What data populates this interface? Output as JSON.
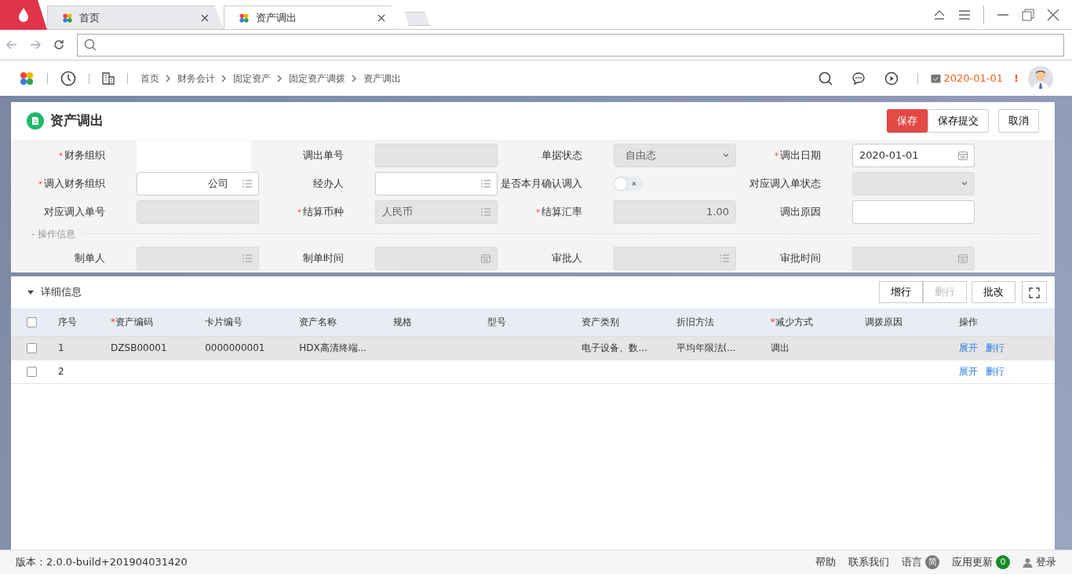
{
  "browser": {
    "tabs": [
      {
        "label": "首页",
        "selected": false
      },
      {
        "label": "资产调出",
        "selected": true
      }
    ]
  },
  "app_header": {
    "breadcrumb": [
      "首页",
      "财务会计",
      "固定资产",
      "固定资产调拨",
      "资产调出"
    ],
    "date": "2020-01-01",
    "alert": "!"
  },
  "page": {
    "title": "资产调出",
    "buttons": [
      {
        "label": "保存",
        "kind": "primary"
      },
      {
        "label": "保存提交",
        "kind": "default"
      },
      {
        "label": "取消",
        "kind": "default"
      }
    ]
  },
  "required_mark": "*",
  "form": {
    "fields": [
      {
        "label": "财务组织",
        "required": true,
        "kind": "redacted"
      },
      {
        "label": "调出单号",
        "required": false,
        "kind": "text",
        "disabled": true
      },
      {
        "label": "单据状态",
        "required": false,
        "kind": "select",
        "value": "自由态",
        "disabled": true
      },
      {
        "label": "调出日期",
        "required": true,
        "kind": "date",
        "value": "2020-01-01",
        "disabled": false
      },
      {
        "label": "调入财务组织",
        "required": true,
        "kind": "list",
        "value": "公司",
        "disabled": false
      },
      {
        "label": "经办人",
        "required": false,
        "kind": "list",
        "disabled": false
      },
      {
        "label": "是否本月确认调入",
        "required": false,
        "kind": "toggle",
        "on": false
      },
      {
        "label": "对应调入单状态",
        "required": false,
        "kind": "select",
        "disabled": true
      },
      {
        "label": "对应调入单号",
        "required": false,
        "kind": "text",
        "disabled": true
      },
      {
        "label": "结算币种",
        "required": true,
        "kind": "list",
        "value": "人民币",
        "disabled": true
      },
      {
        "label": "结算汇率",
        "required": true,
        "kind": "number",
        "value": "1.00",
        "disabled": true
      },
      {
        "label": "调出原因",
        "required": false,
        "kind": "text",
        "disabled": false
      }
    ],
    "section": "- 操作信息",
    "section_fields": [
      {
        "label": "制单人",
        "required": false,
        "kind": "list",
        "disabled": true
      },
      {
        "label": "制单时间",
        "required": false,
        "kind": "date",
        "disabled": true
      },
      {
        "label": "审批人",
        "required": false,
        "kind": "list",
        "disabled": true
      },
      {
        "label": "审批时间",
        "required": false,
        "kind": "date",
        "disabled": true
      }
    ]
  },
  "detail": {
    "title": "详细信息",
    "expanded": true,
    "all_checked": false,
    "buttons": [
      {
        "label": "增行",
        "disabled": false
      },
      {
        "label": "删行",
        "disabled": true
      },
      {
        "label": "批改",
        "disabled": false
      }
    ],
    "columns": [
      {
        "label": "序号",
        "required": false
      },
      {
        "label": "资产编码",
        "required": true
      },
      {
        "label": "卡片编号",
        "required": false
      },
      {
        "label": "资产名称",
        "required": false
      },
      {
        "label": "规格",
        "required": false
      },
      {
        "label": "型号",
        "required": false
      },
      {
        "label": "资产类别",
        "required": false
      },
      {
        "label": "折旧方法",
        "required": false
      },
      {
        "label": "减少方式",
        "required": true
      },
      {
        "label": "调拨原因",
        "required": false
      },
      {
        "label": "操作",
        "required": false
      }
    ],
    "rows": [
      {
        "checked": false,
        "highlighted": true,
        "cells": [
          "1",
          "DZSB00001",
          "0000000001",
          "HDX高清终端...",
          "",
          "",
          "电子设备、数...",
          "平均年限法(...",
          "调出",
          ""
        ],
        "actions": [
          "展开",
          "删行"
        ]
      },
      {
        "checked": false,
        "highlighted": false,
        "cells": [
          "2",
          "",
          "",
          "",
          "",
          "",
          "",
          "",
          "",
          ""
        ],
        "actions": [
          "展开",
          "删行"
        ]
      }
    ]
  },
  "footer": {
    "version": "版本：2.0.0-build+201904031420",
    "links": [
      "帮助",
      "联系我们"
    ],
    "language": "语言",
    "language_badge": "简",
    "updates": "应用更新",
    "updates_count": "0",
    "login": "登录"
  }
}
